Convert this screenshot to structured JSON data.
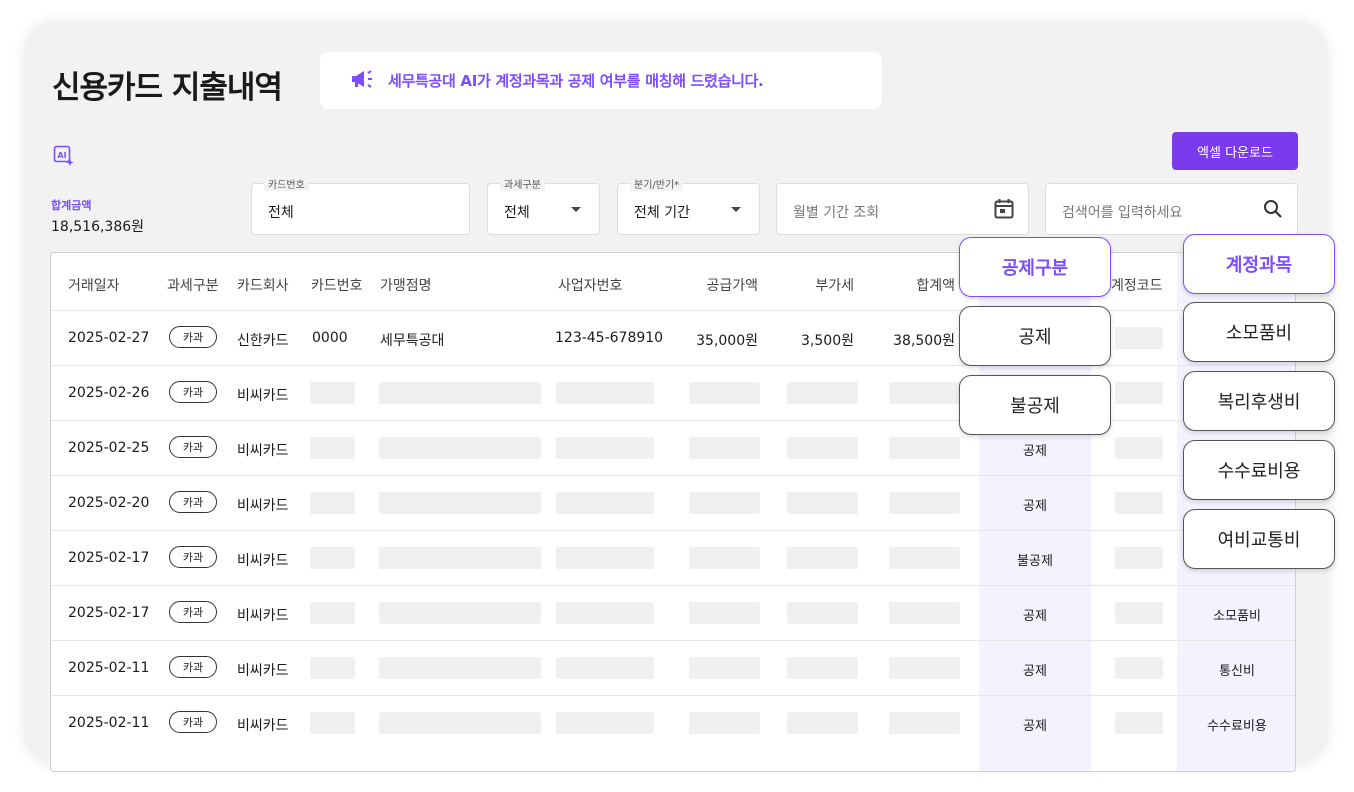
{
  "page": {
    "title": "신용카드 지출내역",
    "notice": "세무특공대 AI가 계정과목과 공제 여부를 매칭해 드렸습니다.",
    "total_label": "합계금액",
    "total_value": "18,516,386원",
    "excel_button": "엑셀 다운로드"
  },
  "filters": {
    "card_label": "카드번호",
    "card_value": "전체",
    "tax_label": "과세구분",
    "tax_value": "전체",
    "period_label": "분기/반기*",
    "period_value": "전체 기간",
    "month_placeholder": "월별 기간 조회",
    "search_placeholder": "검색어를 입력하세요"
  },
  "table": {
    "headers": {
      "date": "거래일자",
      "tax": "과세구분",
      "company": "카드회사",
      "cardno": "카드번호",
      "merchant": "가맹점명",
      "bizno": "사업자번호",
      "supply": "공급가액",
      "vat": "부가세",
      "total": "합계액",
      "code": "계정코드"
    },
    "rows": [
      {
        "date": "2025-02-27",
        "tax": "카과",
        "company": "신한카드",
        "cardno": "0000",
        "merchant": "세무특공대",
        "bizno": "123-45-678910",
        "supply": "35,000원",
        "vat": "3,500원",
        "total": "38,500원",
        "deduct": "",
        "account": ""
      },
      {
        "date": "2025-02-26",
        "tax": "카과",
        "company": "비씨카드",
        "deduct": "",
        "account": ""
      },
      {
        "date": "2025-02-25",
        "tax": "카과",
        "company": "비씨카드",
        "deduct": "공제",
        "account": ""
      },
      {
        "date": "2025-02-20",
        "tax": "카과",
        "company": "비씨카드",
        "deduct": "공제",
        "account": ""
      },
      {
        "date": "2025-02-17",
        "tax": "카과",
        "company": "비씨카드",
        "deduct": "불공제",
        "account": ""
      },
      {
        "date": "2025-02-17",
        "tax": "카과",
        "company": "비씨카드",
        "deduct": "공제",
        "account": "소모품비"
      },
      {
        "date": "2025-02-11",
        "tax": "카과",
        "company": "비씨카드",
        "deduct": "공제",
        "account": "통신비"
      },
      {
        "date": "2025-02-11",
        "tax": "카과",
        "company": "비씨카드",
        "deduct": "공제",
        "account": "수수료비용"
      }
    ]
  },
  "highlight": {
    "deduct_header": "공제구분",
    "deduct_options": [
      "공제",
      "불공제"
    ],
    "account_header": "계정과목",
    "account_options": [
      "소모품비",
      "복리후생비",
      "수수료비용",
      "여비교통비"
    ]
  },
  "colors": {
    "accent": "#7c4dff",
    "button": "#7c3aed"
  }
}
